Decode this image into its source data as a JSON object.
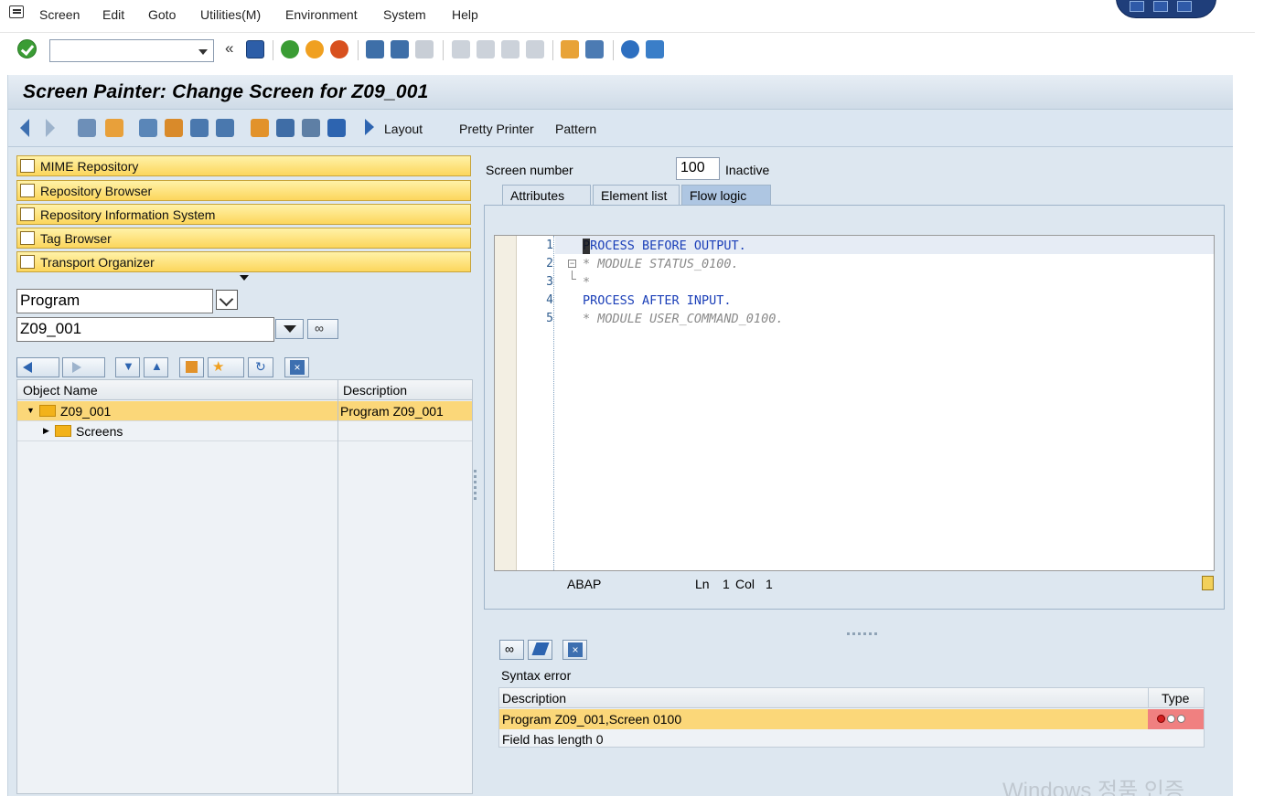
{
  "menu": {
    "items": [
      "Screen",
      "Edit",
      "Goto",
      "Utilities(M)",
      "Environment",
      "System",
      "Help"
    ]
  },
  "standard_toolbar": {
    "command_field_value": ""
  },
  "title": "Screen Painter: Change Screen for Z09_001",
  "app_toolbar": {
    "layout_label": "Layout",
    "pretty_printer_label": "Pretty Printer",
    "pattern_label": "Pattern"
  },
  "navigator": {
    "buttons": [
      "MIME Repository",
      "Repository Browser",
      "Repository Information System",
      "Tag Browser",
      "Transport Organizer"
    ],
    "object_type": "Program",
    "object_name": "Z09_001"
  },
  "tree": {
    "headers": {
      "object_name": "Object Name",
      "description": "Description"
    },
    "rows": [
      {
        "name": "Z09_001",
        "description": "Program Z09_001"
      },
      {
        "name": "Screens",
        "description": ""
      }
    ]
  },
  "screen": {
    "number_label": "Screen number",
    "number": "100",
    "status": "Inactive",
    "tabs": [
      "Attributes",
      "Element list",
      "Flow logic"
    ],
    "active_tab": "Flow logic"
  },
  "editor": {
    "lines": [
      {
        "n": "1",
        "text": "PROCESS BEFORE OUTPUT.",
        "kind": "keyword"
      },
      {
        "n": "2",
        "text": "* MODULE STATUS_0100.",
        "kind": "comment"
      },
      {
        "n": "3",
        "text": "*",
        "kind": "comment"
      },
      {
        "n": "4",
        "text": "PROCESS AFTER INPUT.",
        "kind": "keyword"
      },
      {
        "n": "5",
        "text": "* MODULE USER_COMMAND_0100.",
        "kind": "comment"
      }
    ],
    "status": {
      "language": "ABAP",
      "ln_label": "Ln",
      "ln": "1",
      "col_label": "Col",
      "col": "1"
    }
  },
  "syntax": {
    "title": "Syntax error",
    "headers": {
      "description": "Description",
      "type": "Type"
    },
    "rows": [
      {
        "description": "Program Z09_001,Screen 0100"
      },
      {
        "description": "Field  has length 0"
      }
    ]
  },
  "watermark": "Windows 정품 인증",
  "colors": {
    "accent_yellow": "#fcd65c",
    "selection": "#fbd779",
    "keyword": "#1b3fb8",
    "error_type": "#f08080"
  }
}
